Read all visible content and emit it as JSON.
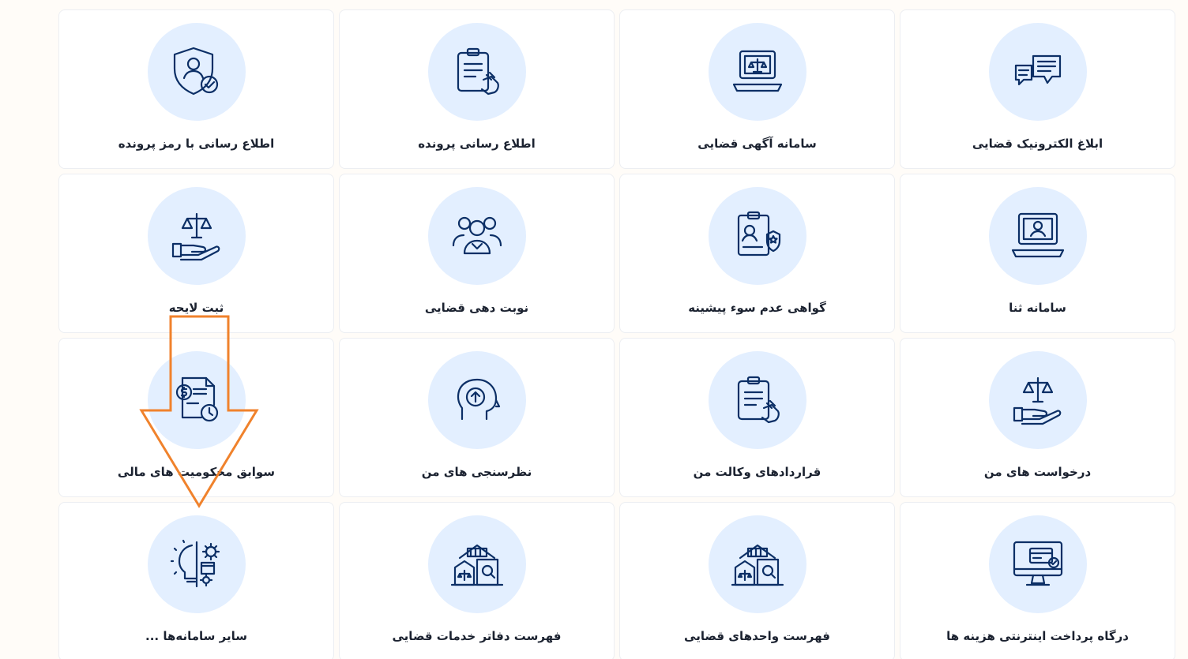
{
  "cards": [
    {
      "label": "ابلاغ الکترونیک قضایی",
      "icon": "chat-bubbles-icon"
    },
    {
      "label": "سامانه آگهی قضایی",
      "icon": "laptop-scales-icon"
    },
    {
      "label": "اطلاع رسانی پرونده",
      "icon": "clipboard-hand-icon"
    },
    {
      "label": "اطلاع رسانی با رمز پرونده",
      "icon": "shield-user-check-icon"
    },
    {
      "label": "سامانه ثنا",
      "icon": "laptop-user-icon"
    },
    {
      "label": "گواهی عدم سوء پیشینه",
      "icon": "clipboard-badge-icon"
    },
    {
      "label": "نوبت دهی قضایی",
      "icon": "people-group-icon"
    },
    {
      "label": "ثبت لایحه",
      "icon": "hand-scales-icon"
    },
    {
      "label": "درخواست های من",
      "icon": "hand-scales-icon"
    },
    {
      "label": "قراردادهای وکالت من",
      "icon": "clipboard-hand-icon"
    },
    {
      "label": "نظرسنجی های من",
      "icon": "head-arrow-icon"
    },
    {
      "label": "سوابق محکومیت های مالی",
      "icon": "money-document-clock-icon"
    },
    {
      "label": "درگاه پرداخت اینترنتی هزینه ها",
      "icon": "monitor-card-icon"
    },
    {
      "label": "فهرست واحدهای قضایی",
      "icon": "buildings-search-icon"
    },
    {
      "label": "فهرست دفاتر خدمات قضایی",
      "icon": "buildings-search-icon"
    },
    {
      "label": "سایر سامانه‌ها ...",
      "icon": "bulb-gears-icon"
    }
  ],
  "colors": {
    "accent_circle": "#e3efff",
    "icon_stroke": "#0c2f66",
    "annotation_arrow": "#f0822c"
  }
}
